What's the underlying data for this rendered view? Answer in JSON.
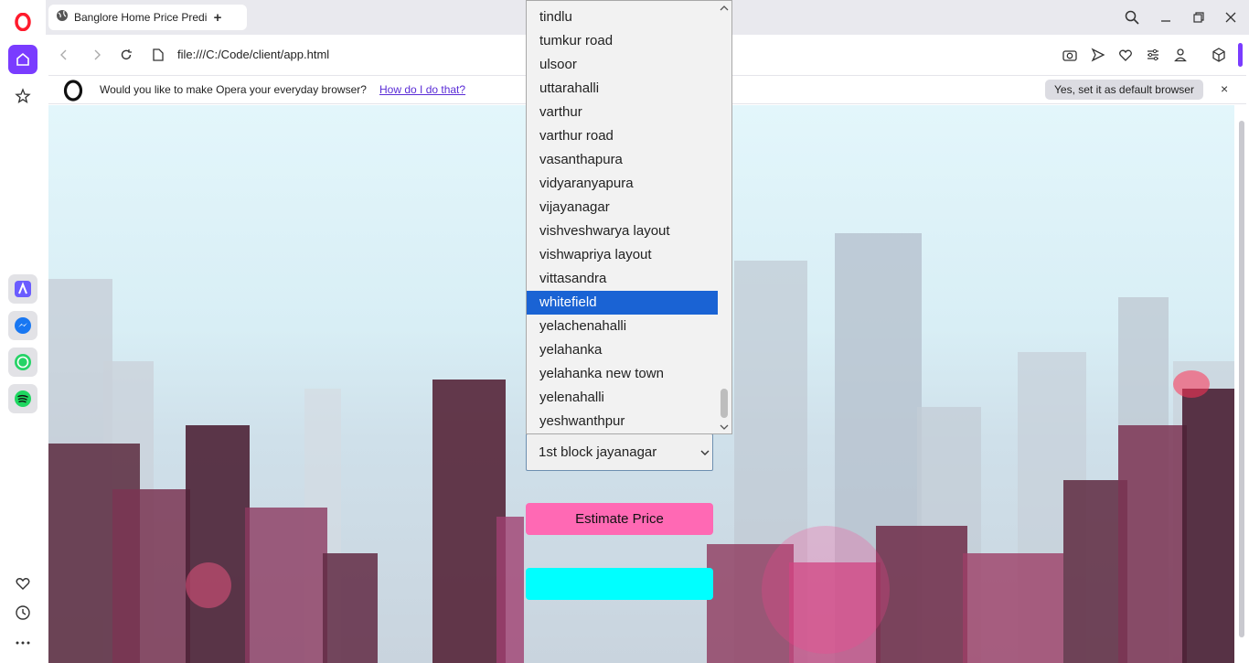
{
  "tab": {
    "title": "Banglore Home Price Predi"
  },
  "address": {
    "url": "file:///C:/Code/client/app.html"
  },
  "infobar": {
    "message": "Would you like to make Opera your everyday browser?",
    "link": "How do I do that?",
    "default_button": "Yes, set it as default browser",
    "close": "×"
  },
  "new_tab": "+",
  "form": {
    "location_value": "1st block jayanagar",
    "estimate_label": "Estimate Price"
  },
  "dropdown": {
    "options": [
      "tindlu",
      "tumkur road",
      "ulsoor",
      "uttarahalli",
      "varthur",
      "varthur road",
      "vasanthapura",
      "vidyaranyapura",
      "vijayanagar",
      "vishveshwarya layout",
      "vishwapriya layout",
      "vittasandra",
      "whitefield",
      "yelachenahalli",
      "yelahanka",
      "yelahanka new town",
      "yelenahalli",
      "yeshwanthpur"
    ],
    "selected": "whitefield"
  },
  "colors": {
    "opera_accent": "#7a3cff",
    "opera_red": "#ff1b2d",
    "estimate_button": "#ff69b4",
    "result_box": "#00ffff",
    "selected_option": "#1a63d4"
  }
}
